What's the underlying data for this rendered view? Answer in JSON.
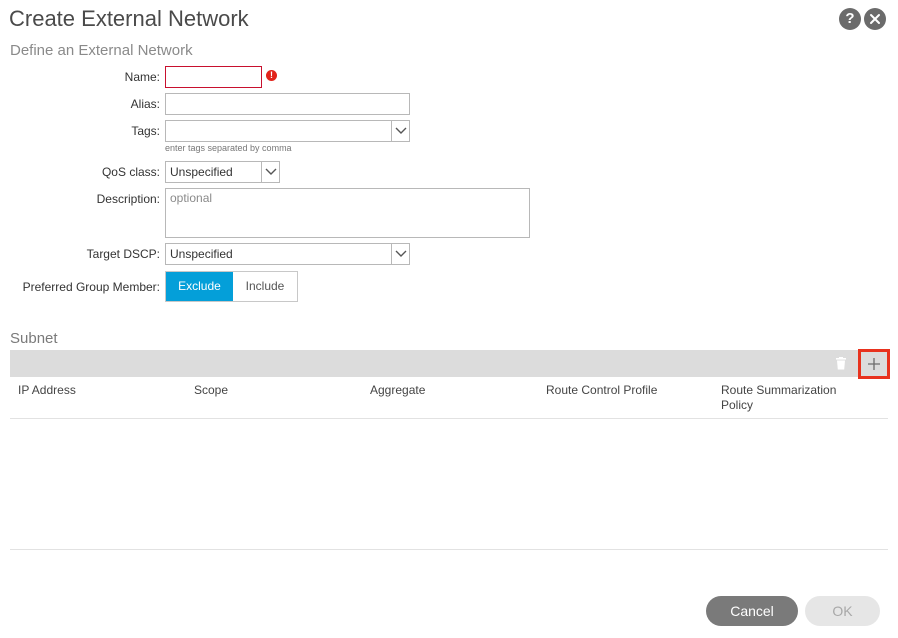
{
  "dialog": {
    "title": "Create External Network",
    "subtitle": "Define an External Network"
  },
  "form": {
    "name_label": "Name:",
    "name_value": "",
    "alias_label": "Alias:",
    "alias_value": "",
    "tags_label": "Tags:",
    "tags_hint": "enter tags separated by comma",
    "qos_label": "QoS class:",
    "qos_value": "Unspecified",
    "description_label": "Description:",
    "description_placeholder": "optional",
    "dscp_label": "Target DSCP:",
    "dscp_value": "Unspecified",
    "preferred_label": "Preferred Group Member:",
    "preferred_options": [
      "Exclude",
      "Include"
    ],
    "preferred_selected": "Exclude"
  },
  "subnet": {
    "title": "Subnet",
    "columns": [
      "IP Address",
      "Scope",
      "Aggregate",
      "Route Control Profile",
      "Route Summarization Policy"
    ],
    "rows": []
  },
  "footer": {
    "cancel_label": "Cancel",
    "ok_label": "OK"
  },
  "icons": {
    "help": "help-icon",
    "close": "close-icon",
    "error": "error-icon",
    "trash": "trash-icon",
    "add": "add-icon"
  },
  "colors": {
    "accent": "#049fd9",
    "error": "#e2231a",
    "highlight": "#e8321e"
  }
}
